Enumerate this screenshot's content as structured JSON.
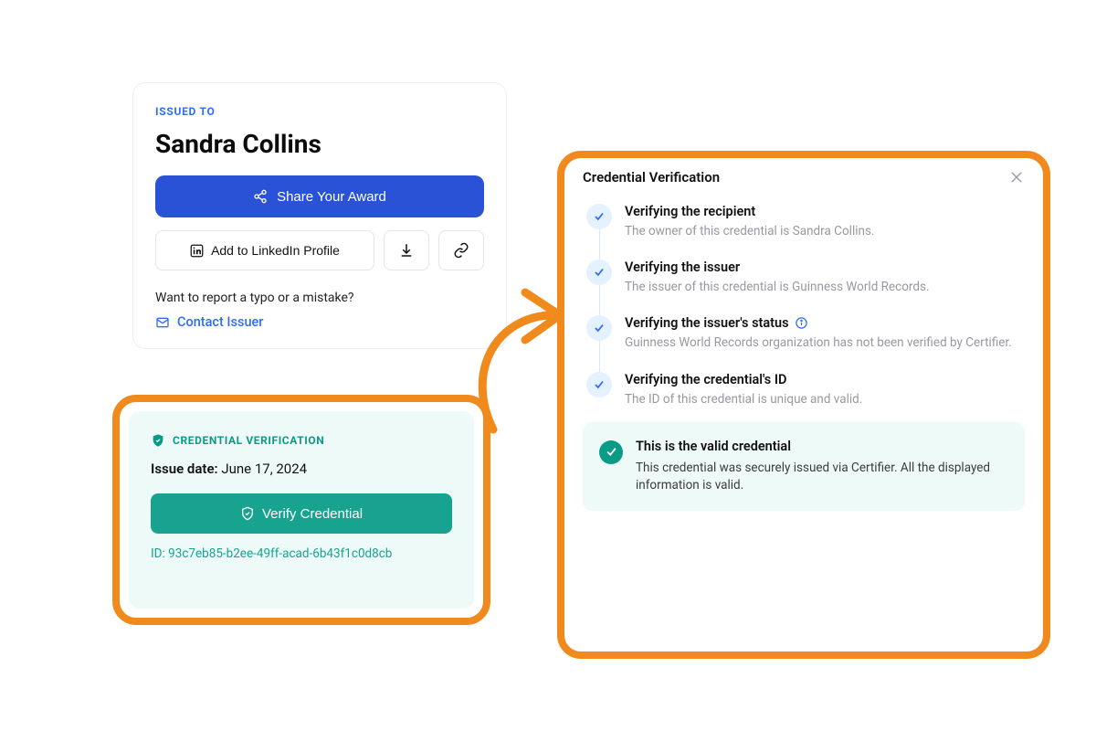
{
  "award": {
    "issuedToLabel": "ISSUED TO",
    "recipientName": "Sandra Collins",
    "shareButton": "Share Your Award",
    "linkedinButton": "Add to LinkedIn Profile",
    "reportText": "Want to report a typo or a mistake?",
    "contactIssuer": "Contact Issuer"
  },
  "verifBox": {
    "title": "CREDENTIAL VERIFICATION",
    "issueDateLabel": "Issue date:",
    "issueDateValue": "June 17, 2024",
    "verifyButton": "Verify Credential",
    "idLabel": "ID:",
    "idValue": "93c7eb85-b2ee-49ff-acad-6b43f1c0d8cb"
  },
  "panel": {
    "title": "Credential Verification",
    "steps": [
      {
        "title": "Verifying the recipient",
        "desc": "The owner of this credential is Sandra Collins."
      },
      {
        "title": "Verifying the issuer",
        "desc": "The issuer of this credential is Guinness World Records."
      },
      {
        "title": "Verifying the issuer's status",
        "desc": "Guinness World Records organization has not been verified by Certifier.",
        "info": true
      },
      {
        "title": "Verifying the credential's ID",
        "desc": "The ID of this credential is unique and valid."
      }
    ],
    "validTitle": "This is the valid credential",
    "validDesc": "This credential was securely issued via Certifier. All the displayed information is valid."
  }
}
